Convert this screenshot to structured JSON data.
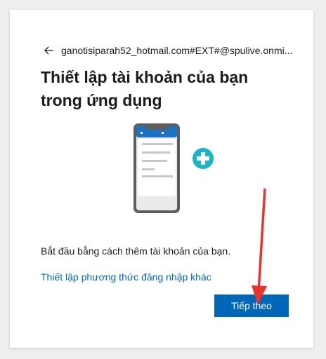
{
  "account": {
    "identity": "ganotisiparah52_hotmail.com#EXT#@spulive.onmi..."
  },
  "page": {
    "title": "Thiết lập tài khoản của bạn trong ứng dụng",
    "description": "Bắt đầu bằng cách thêm tài khoản của bạn.",
    "alt_link": "Thiết lập phương thức đăng nhập khác"
  },
  "actions": {
    "next_label": "Tiếp theo"
  },
  "icons": {
    "back": "back-arrow-icon",
    "illustration": "phone-add-account-illustration",
    "annotation": "red-arrow-annotation"
  },
  "colors": {
    "accent": "#0067b8",
    "plus_badge": "#1ab5c9",
    "annotation": "#e8332d"
  }
}
